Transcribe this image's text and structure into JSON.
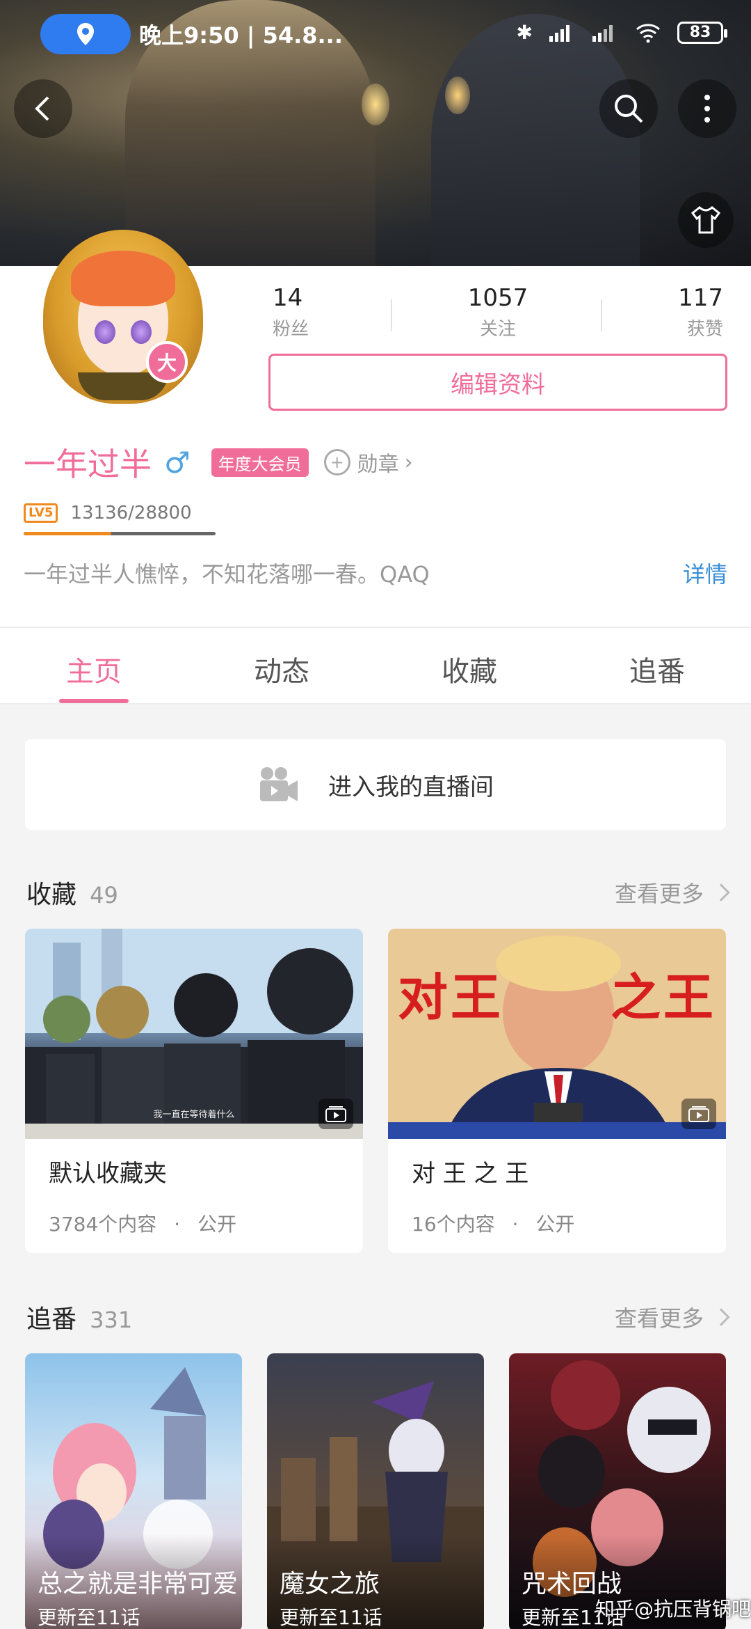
{
  "status_bar": {
    "time_text": "晚上9:50 | 54.8...",
    "battery": "83"
  },
  "profile": {
    "stats": [
      {
        "num": "14",
        "label": "粉丝"
      },
      {
        "num": "1057",
        "label": "关注"
      },
      {
        "num": "117",
        "label": "获赞"
      }
    ],
    "edit_label": "编辑资料",
    "username": "一年过半",
    "gender_symbol": "♂",
    "vip_tag": "年度大会员",
    "vip_badge": "大",
    "medal_label": "勋章",
    "level_badge": "LV5",
    "exp_text": "13136/28800",
    "exp_fraction": 0.456,
    "signature": "一年过半人憔悴，不知花落哪一春。QAQ",
    "detail_link": "详情"
  },
  "tabs": [
    "主页",
    "动态",
    "收藏",
    "追番"
  ],
  "live": {
    "label": "进入我的直播间"
  },
  "favorites": {
    "title": "收藏",
    "count": "49",
    "more": "查看更多",
    "items": [
      {
        "title": "默认收藏夹",
        "count": "3784个内容",
        "dot": "·",
        "visibility": "公开",
        "subtitle": "我一直在等待着什么"
      },
      {
        "title": "对 王 之 王",
        "count": "16个内容",
        "dot": "·",
        "visibility": "公开",
        "cover_text_left": "对王",
        "cover_text_right": "之王"
      }
    ]
  },
  "bangumi": {
    "title": "追番",
    "count": "331",
    "more": "查看更多",
    "items": [
      {
        "title": "总之就是非常可爱",
        "episode": "更新至11话"
      },
      {
        "title": "魔女之旅",
        "episode": "更新至11话"
      },
      {
        "title": "咒术回战",
        "episode": "更新至11话"
      }
    ]
  },
  "watermark": "知乎@抗压背锅吧",
  "colors": {
    "accent": "#f06d9a",
    "link": "#3b8fd6",
    "level": "#f08a1e"
  }
}
